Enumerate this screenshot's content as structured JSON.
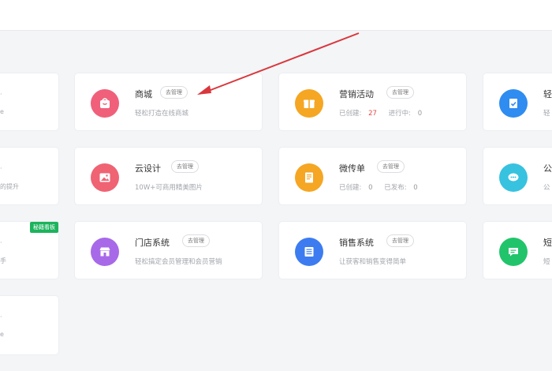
{
  "manage_label": "去管理",
  "left_column": {
    "fragments": [
      "·",
      "e",
      "·",
      "·",
      "的提升",
      "·",
      "手",
      "·",
      "e"
    ],
    "badge": "秘籍看板"
  },
  "cards": [
    {
      "key": "mall",
      "title": "商城",
      "manage": "去管理",
      "desc": "轻松打造在线商城",
      "icon": "shop-bag-icon",
      "color": "#f0607a"
    },
    {
      "key": "marketing",
      "title": "营销活动",
      "manage": "去管理",
      "desc_a": "已创建:",
      "count_a": "27",
      "desc_b": "进行中:",
      "count_b": "0",
      "icon": "gift-icon",
      "color": "#f5a623"
    },
    {
      "key": "cloud-design",
      "title": "云设计",
      "manage": "去管理",
      "desc": "10W+可商用精美图片",
      "icon": "image-icon",
      "color": "#ef6373"
    },
    {
      "key": "flyer",
      "title": "微传单",
      "manage": "去管理",
      "desc_a": "已创建:",
      "count_a": "0",
      "desc_b": "已发布:",
      "count_b": "0",
      "icon": "document-icon",
      "color": "#f5a623"
    },
    {
      "key": "store-system",
      "title": "门店系统",
      "manage": "去管理",
      "desc": "轻松搞定会员管理和会员营销",
      "icon": "storefront-icon",
      "color": "#a769e8"
    },
    {
      "key": "sales-system",
      "title": "销售系统",
      "manage": "去管理",
      "desc": "让获客和销售变得简单",
      "icon": "list-icon",
      "color": "#3c7cf0"
    }
  ],
  "right_column": {
    "titles": [
      "轻",
      "公",
      "短"
    ],
    "subs": [
      "轻",
      "公",
      "短"
    ],
    "colors": [
      "#2f8cf0",
      "#37c2e0",
      "#22c46b"
    ]
  }
}
